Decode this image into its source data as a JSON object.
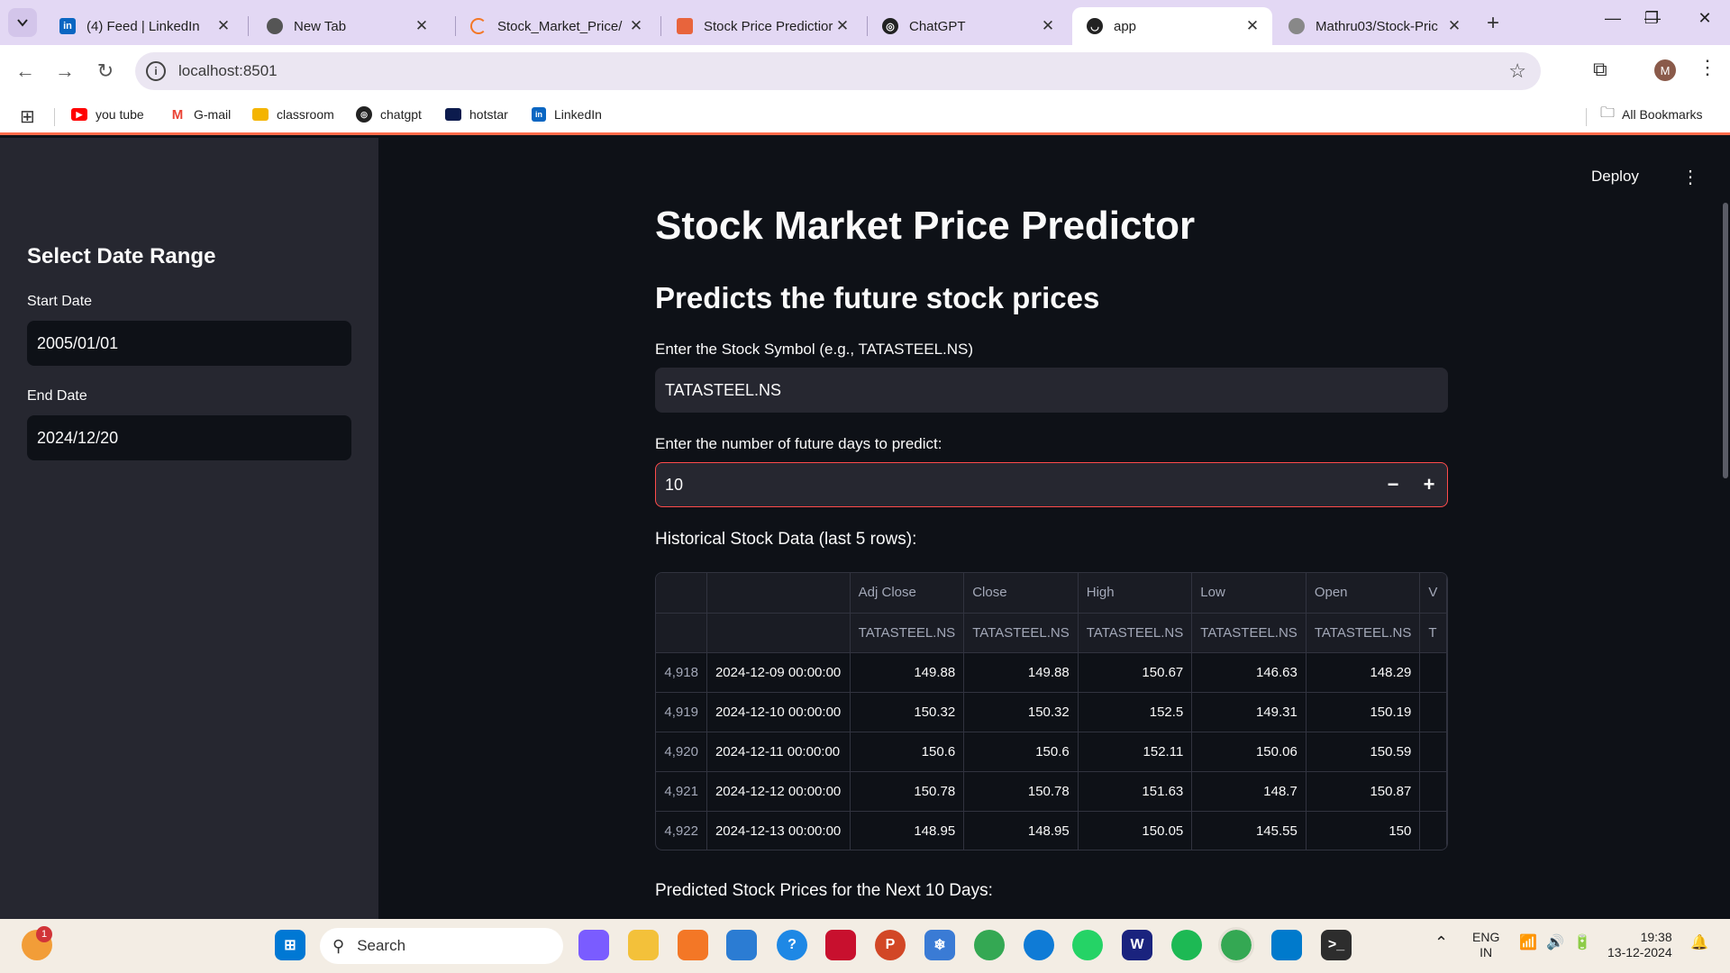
{
  "browser": {
    "tabs": [
      {
        "title": "(4) Feed | LinkedIn",
        "icon": "linkedin-icon",
        "color": "#0a66c2"
      },
      {
        "title": "New Tab",
        "icon": "chrome-icon",
        "color": "#555555"
      },
      {
        "title": "Stock_Market_Price/",
        "icon": "jupyter-icon",
        "color": "#f37726"
      },
      {
        "title": "Stock Price Predictior",
        "icon": "notebook-icon",
        "color": "#e8643c"
      },
      {
        "title": "ChatGPT",
        "icon": "chatgpt-icon",
        "color": "#222222"
      },
      {
        "title": "app",
        "icon": "streamlit-icon",
        "color": "#222222"
      },
      {
        "title": "Mathru03/Stock-Pric",
        "icon": "github-icon",
        "color": "#888888"
      }
    ],
    "url": "localhost:8501",
    "bookmarks": [
      {
        "label": "you tube",
        "icon": "youtube-icon",
        "color": "#ff0000"
      },
      {
        "label": "G-mail",
        "icon": "gmail-icon",
        "color": "#ea4335"
      },
      {
        "label": "classroom",
        "icon": "classroom-icon",
        "color": "#f4b400"
      },
      {
        "label": "chatgpt",
        "icon": "chatgpt-icon",
        "color": "#222222"
      },
      {
        "label": "hotstar",
        "icon": "hotstar-icon",
        "color": "#0c1b4d"
      },
      {
        "label": "LinkedIn",
        "icon": "linkedin-icon",
        "color": "#0a66c2"
      }
    ],
    "all_bookmarks": "All Bookmarks",
    "profile_initial": "M"
  },
  "app": {
    "deploy": "Deploy",
    "sidebar": {
      "heading": "Select Date Range",
      "start_label": "Start Date",
      "start_value": "2005/01/01",
      "end_label": "End Date",
      "end_value": "2024/12/20"
    },
    "title": "Stock Market Price Predictor",
    "subtitle": "Predicts the future stock prices",
    "symbol_label": "Enter the Stock Symbol (e.g., TATASTEEL.NS)",
    "symbol_value": "TATASTEEL.NS",
    "days_label": "Enter the number of future days to predict:",
    "days_value": "10",
    "historical_heading": "Historical Stock Data (last 5 rows):",
    "predicted_heading": "Predicted Stock Prices for the Next 10 Days:",
    "table": {
      "columns": [
        "Adj Close",
        "Close",
        "High",
        "Low",
        "Open",
        "V"
      ],
      "tickers": [
        "TATASTEEL.NS",
        "TATASTEEL.NS",
        "TATASTEEL.NS",
        "TATASTEEL.NS",
        "TATASTEEL.NS",
        "T"
      ],
      "rows": [
        {
          "idx": "4,918",
          "date": "2024-12-09 00:00:00",
          "vals": [
            "149.88",
            "149.88",
            "150.67",
            "146.63",
            "148.29",
            ""
          ]
        },
        {
          "idx": "4,919",
          "date": "2024-12-10 00:00:00",
          "vals": [
            "150.32",
            "150.32",
            "152.5",
            "149.31",
            "150.19",
            ""
          ]
        },
        {
          "idx": "4,920",
          "date": "2024-12-11 00:00:00",
          "vals": [
            "150.6",
            "150.6",
            "152.11",
            "150.06",
            "150.59",
            ""
          ]
        },
        {
          "idx": "4,921",
          "date": "2024-12-12 00:00:00",
          "vals": [
            "150.78",
            "150.78",
            "151.63",
            "148.7",
            "150.87",
            ""
          ]
        },
        {
          "idx": "4,922",
          "date": "2024-12-13 00:00:00",
          "vals": [
            "148.95",
            "148.95",
            "150.05",
            "145.55",
            "150",
            ""
          ]
        }
      ]
    }
  },
  "taskbar": {
    "search_label": "Search",
    "notification_count": "1",
    "language": "ENG",
    "region": "IN",
    "time": "19:38",
    "date": "13-12-2024"
  }
}
